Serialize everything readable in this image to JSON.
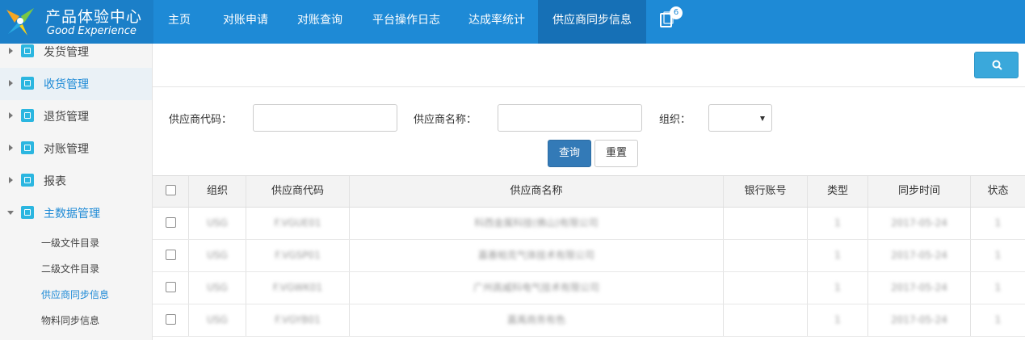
{
  "brand": {
    "title_cn": "产品体验中心",
    "title_en": "Good Experience"
  },
  "nav": {
    "items": [
      "主页",
      "对账申请",
      "对账查询",
      "平台操作日志",
      "达成率统计",
      "供应商同步信息"
    ],
    "notification_count": "6"
  },
  "sidebar": {
    "items": [
      "发货管理",
      "收货管理",
      "退货管理",
      "对账管理",
      "报表",
      "主数据管理"
    ],
    "subitems": [
      "一级文件目录",
      "二级文件目录",
      "供应商同步信息",
      "物料同步信息"
    ]
  },
  "search_form": {
    "supplier_code_label": "供应商代码：",
    "supplier_name_label": "供应商名称：",
    "org_label": "组织：",
    "supplier_code_value": "",
    "supplier_name_value": "",
    "query_button": "查询",
    "reset_button": "重置"
  },
  "table": {
    "headers": [
      "组织",
      "供应商代码",
      "供应商名称",
      "银行账号",
      "类型",
      "同步时间",
      "状态"
    ],
    "rows": [
      [
        "USG",
        "F.VGUE01",
        "科西金属科技(佛山)有限公司",
        "",
        "1",
        "2017-05-24",
        "1"
      ],
      [
        "USG",
        "F.VGSP01",
        "嘉善帕克气体技术有限公司",
        "",
        "1",
        "2017-05-24",
        "1"
      ],
      [
        "USG",
        "F.VGWK01",
        "广州高威科电气技术有限公司",
        "",
        "1",
        "2017-05-24",
        "1"
      ],
      [
        "USG",
        "F.VGYB01",
        "嘉禹商务有色",
        "",
        "1",
        "2017-05-24",
        "1"
      ]
    ]
  },
  "colors": {
    "topbar": "#1e8ad6",
    "active_nav": "#1670b6",
    "primary_button": "#337ab7",
    "search_button": "#3aa8db",
    "accent_icon": "#2bb6e0"
  },
  "icons": [
    "logo-icon",
    "notification-icon",
    "search-icon",
    "cube-icon",
    "caret-right-icon",
    "caret-down-icon",
    "chevron-down-icon"
  ]
}
